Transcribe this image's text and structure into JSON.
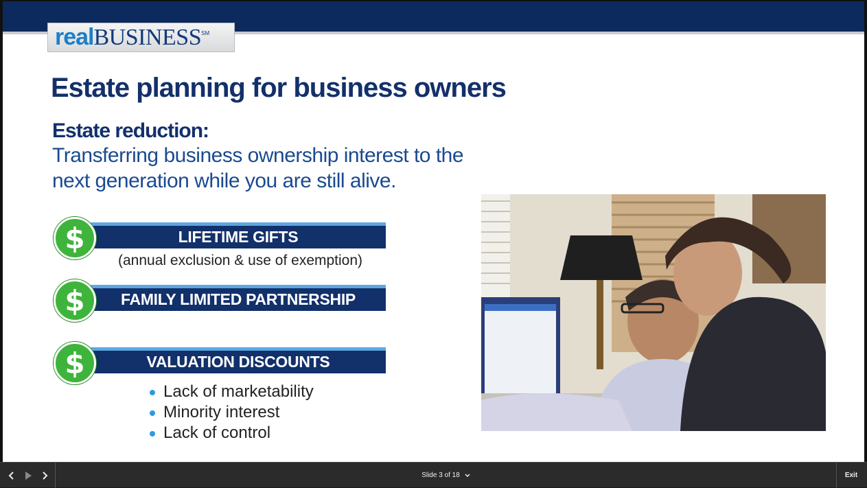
{
  "logo": {
    "real": "real",
    "business": "BUSINESS",
    "mark": "SM"
  },
  "slide": {
    "title": "Estate planning for business owners",
    "subtitle": "Estate reduction:",
    "description": "Transferring business ownership interest to the next generation while you are still alive.",
    "items": [
      {
        "label": "LIFETIME GIFTS",
        "note": "(annual exclusion & use of exemption)",
        "icon": "dollar-coin-icon"
      },
      {
        "label": "FAMILY LIMITED PARTNERSHIP",
        "icon": "dollar-coin-icon"
      },
      {
        "label": "VALUATION DISCOUNTS",
        "icon": "dollar-coin-icon"
      }
    ],
    "coin_symbol": "$",
    "bullets": [
      "Lack of marketability",
      "Minority interest",
      "Lack of control"
    ]
  },
  "player": {
    "counter": "Slide 3 of 18",
    "exit": "Exit",
    "icons": {
      "prev": "chevron-left-icon",
      "play": "play-icon",
      "next": "chevron-right-icon",
      "menu": "chevron-down-icon"
    }
  },
  "colors": {
    "navy": "#12306a",
    "accent_blue": "#5ea7e0",
    "coin_green": "#3fb43c",
    "title": "#13306b"
  }
}
